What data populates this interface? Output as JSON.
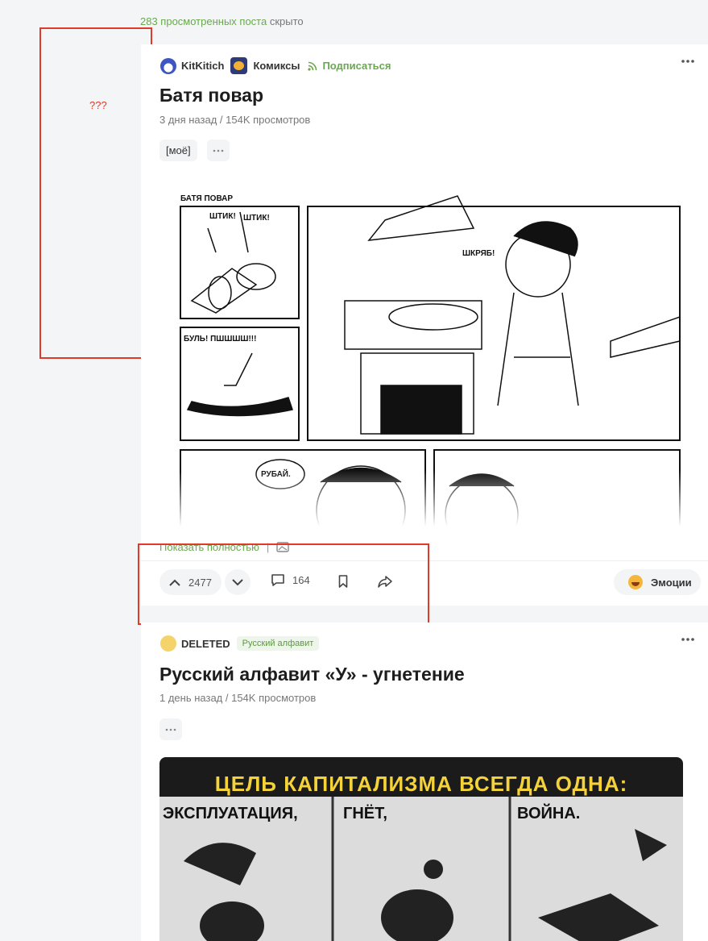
{
  "feed": {
    "hidden_note": {
      "link": "283 просмотренных поста",
      "rest": " скрыто"
    }
  },
  "annotation": {
    "question": "???"
  },
  "post1": {
    "author": "KitKitich",
    "community": "Комиксы",
    "subscribe_label": "Подписаться",
    "title": "Батя повар",
    "meta": "3 дня назад / 154K просмотров",
    "tags": [
      "[моё]"
    ],
    "image": {
      "heading": "БАТЯ ПОВАР",
      "sfx": [
        "ШТИК!",
        "ШТИК!",
        "ШКРЯБ!",
        "БУЛЬ! ПШШШШ!!!",
        "РУБАЙ."
      ]
    },
    "show_full_label": "Показать полностью",
    "show_full_sep": "|",
    "rating": "2477",
    "comments": "164",
    "emotions_label": "Эмоции"
  },
  "post2": {
    "author": "DELETED",
    "community_tag": "Русский алфавит",
    "title": "Русский алфавит «У» - угнетение",
    "meta": "1 день назад / 154K просмотров",
    "poster": {
      "headline": "ЦЕЛЬ КАПИТАЛИЗМА ВСЕГДА ОДНА:",
      "words": [
        "ЭКСПЛУАТАЦИЯ,",
        "ГНЁТ,",
        "ВОЙНА."
      ]
    }
  },
  "colors": {
    "accent_green": "#6aa84f",
    "annotation_red": "#e03a2a"
  }
}
